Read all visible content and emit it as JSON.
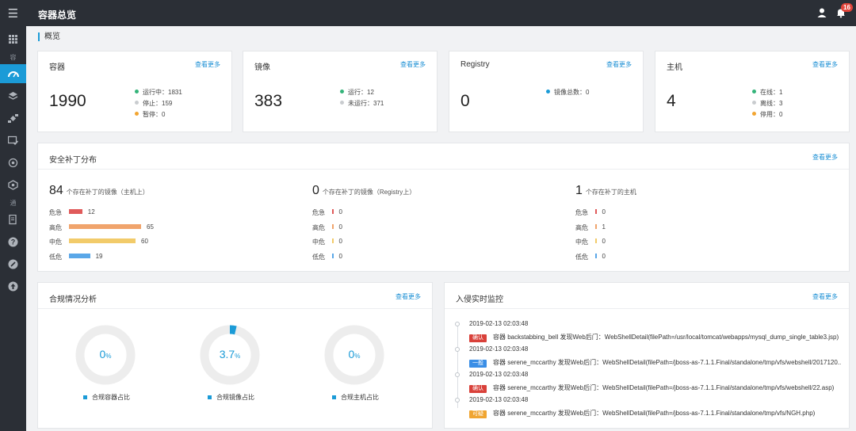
{
  "header": {
    "title": "容器总览",
    "notification_count": "16"
  },
  "breadcrumb": "概览",
  "sidebar": {
    "labels": [
      "容",
      "通"
    ]
  },
  "summary": [
    {
      "title": "容器",
      "more": "查看更多",
      "value": "1990",
      "legend": [
        {
          "label": "运行中：1831",
          "color": "#34b47a"
        },
        {
          "label": "停止：159",
          "color": "#c9cccf"
        },
        {
          "label": "暂停：0",
          "color": "#f2a531"
        }
      ]
    },
    {
      "title": "镜像",
      "more": "查看更多",
      "value": "383",
      "legend": [
        {
          "label": "运行：12",
          "color": "#34b47a"
        },
        {
          "label": "未运行：371",
          "color": "#c9cccf"
        }
      ]
    },
    {
      "title": "Registry",
      "more": "查看更多",
      "value": "0",
      "legend": [
        {
          "label": "镜像总数：0",
          "color": "#1b9bd7"
        }
      ]
    },
    {
      "title": "主机",
      "more": "查看更多",
      "value": "4",
      "legend": [
        {
          "label": "在线：1",
          "color": "#34b47a"
        },
        {
          "label": "离线：3",
          "color": "#c9cccf"
        },
        {
          "label": "停用：0",
          "color": "#f2a531"
        }
      ]
    }
  ],
  "security": {
    "title": "安全补丁分布",
    "more": "查看更多",
    "columns": [
      {
        "total": "84",
        "caption": "个存在补丁的镜像（主机上）",
        "rows": [
          {
            "level": "危急",
            "value": 12,
            "color": "#e05a5a"
          },
          {
            "level": "高危",
            "value": 65,
            "color": "#f0a46c"
          },
          {
            "level": "中危",
            "value": 60,
            "color": "#f2cb6a"
          },
          {
            "level": "低危",
            "value": 19,
            "color": "#5aa7e8"
          }
        ]
      },
      {
        "total": "0",
        "caption": "个存在补丁的镜像（Registry上）",
        "rows": [
          {
            "level": "危急",
            "value": 0,
            "color": "#e05a5a"
          },
          {
            "level": "高危",
            "value": 0,
            "color": "#f0a46c"
          },
          {
            "level": "中危",
            "value": 0,
            "color": "#f2cb6a"
          },
          {
            "level": "低危",
            "value": 0,
            "color": "#5aa7e8"
          }
        ]
      },
      {
        "total": "1",
        "caption": "个存在补丁的主机",
        "rows": [
          {
            "level": "危急",
            "value": 0,
            "color": "#e05a5a"
          },
          {
            "level": "高危",
            "value": 1,
            "color": "#f0a46c"
          },
          {
            "level": "中危",
            "value": 0,
            "color": "#f2cb6a"
          },
          {
            "level": "低危",
            "value": 0,
            "color": "#5aa7e8"
          }
        ]
      }
    ]
  },
  "compliance": {
    "title": "合规情况分析",
    "more": "查看更多",
    "donuts": [
      {
        "number": "0",
        "unit": "%",
        "fraction": 0,
        "label": "合规容器占比"
      },
      {
        "number": "3.7",
        "unit": "%",
        "fraction": 0.037,
        "label": "合规镜像占比"
      },
      {
        "number": "0",
        "unit": "%",
        "fraction": 0,
        "label": "合规主机占比"
      }
    ]
  },
  "intrusion": {
    "title": "入侵实时监控",
    "more": "查看更多",
    "events": [
      {
        "time": "2019-02-13 02:03:48",
        "tag": "确认",
        "tag_color": "#d9413a",
        "text": "容器 backstabbing_bell 发现Web后门：WebShellDetail(filePath=/usr/local/tomcat/webapps/mysql_dump_single_table3.jsp)"
      },
      {
        "time": "2019-02-13 02:03:48",
        "tag": "一般",
        "tag_color": "#3a8ee6",
        "text": "容器 serene_mccarthy 发现Web后门：WebShellDetail(filePath=/jboss-as-7.1.1.Final/standalone/tmp/vfs/webshell/2017120..."
      },
      {
        "time": "2019-02-13 02:03:48",
        "tag": "确认",
        "tag_color": "#d9413a",
        "text": "容器 serene_mccarthy 发现Web后门：WebShellDetail(filePath=/jboss-as-7.1.1.Final/standalone/tmp/vfs/webshell/22.asp)"
      },
      {
        "time": "2019-02-13 02:03:48",
        "tag": "可疑",
        "tag_color": "#f0a531",
        "text": "容器 serene_mccarthy 发现Web后门：WebShellDetail(filePath=/jboss-as-7.1.1.Final/standalone/tmp/vfs/NGH.php)"
      }
    ]
  }
}
